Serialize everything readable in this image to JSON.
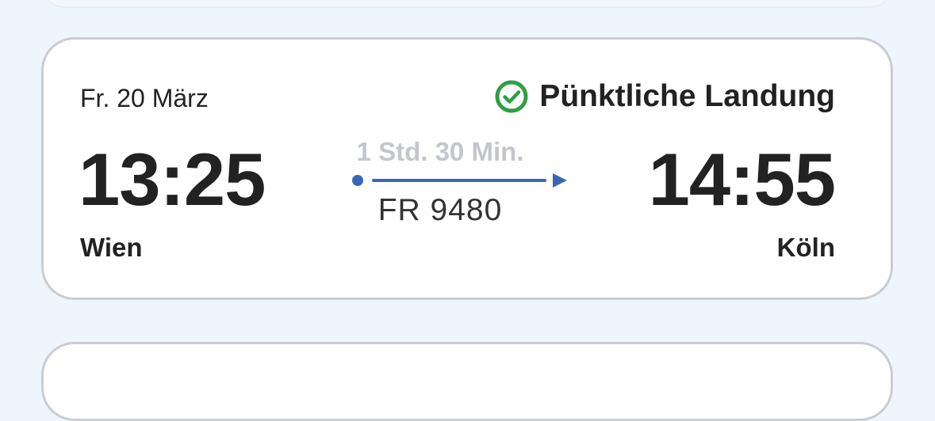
{
  "flight": {
    "date": "Fr. 20 März",
    "status": "Pünktliche Landung",
    "status_color": "#2f9e44",
    "departure": {
      "time": "13:25",
      "city": "Wien"
    },
    "arrival": {
      "time": "14:55",
      "city": "Köln"
    },
    "duration": "1 Std. 30 Min.",
    "flight_number": "FR 9480",
    "route_color": "#3a66b8"
  },
  "icons": {
    "status": "check-circle-icon",
    "route_start": "route-start-dot-icon",
    "route_end": "route-end-arrow-icon"
  }
}
